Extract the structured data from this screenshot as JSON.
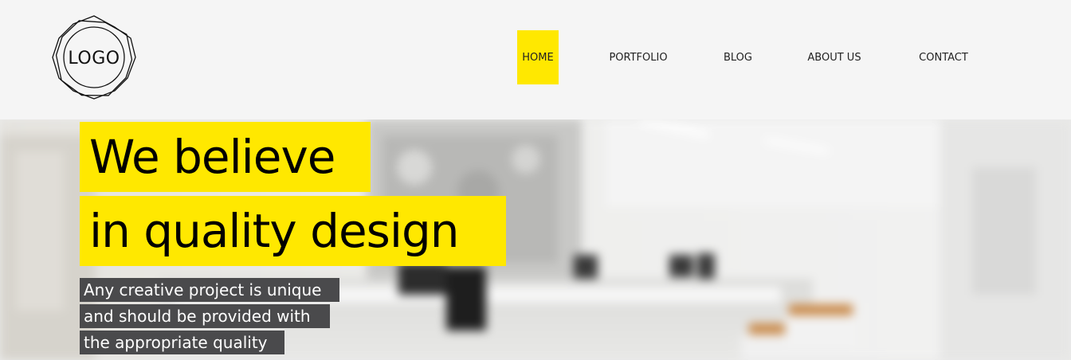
{
  "header": {
    "logo_text": "LOGO",
    "nav": [
      {
        "label": "HOME",
        "active": true
      },
      {
        "label": "PORTFOLIO",
        "active": false
      },
      {
        "label": "BLOG",
        "active": false
      },
      {
        "label": "ABOUT US",
        "active": false
      },
      {
        "label": "CONTACT",
        "active": false
      }
    ]
  },
  "hero": {
    "headline_line1": "We believe",
    "headline_line2": "in quality design",
    "sub_line1": "Any creative project is unique",
    "sub_line2": "and should be provided with",
    "sub_line3": "the appropriate quality"
  },
  "colors": {
    "accent": "#ffe800",
    "header_bg": "#f5f5f5",
    "sub_bg": "#4a4a4c",
    "text_dark": "#000000"
  },
  "icons": [
    "logo-emblem-icon"
  ]
}
